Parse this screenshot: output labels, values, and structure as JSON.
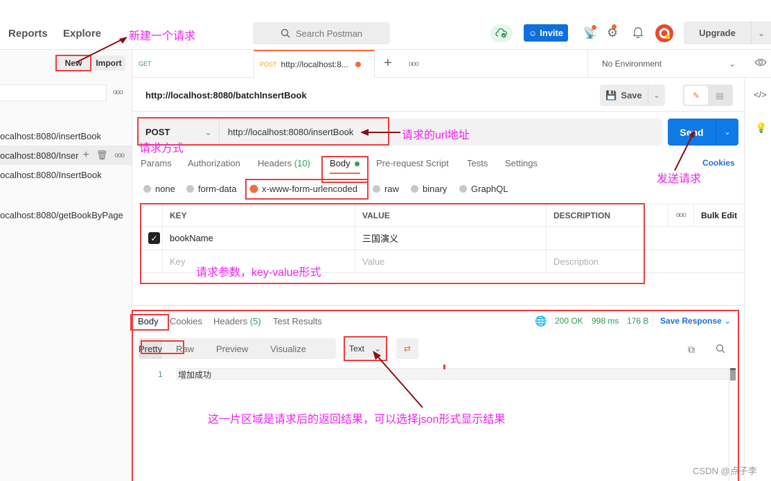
{
  "topbar": {
    "nav": [
      "Reports",
      "Explore"
    ],
    "search_placeholder": "Search Postman",
    "invite_label": "Invite",
    "upgrade_label": "Upgrade",
    "icons": [
      "cloud-sync-icon",
      "satellite-icon",
      "gear-icon",
      "bell-icon",
      "avatar"
    ]
  },
  "sidebar": {
    "new_label": "New",
    "import_label": "Import",
    "items": [
      {
        "label": "ocalhost:8080/insertBook"
      },
      {
        "label": "ocalhost:8080/Inser",
        "active": true
      },
      {
        "label": "ocalhost:8080/InsertBook"
      },
      {
        "label": "ocalhost:8080/getBookByPage"
      }
    ]
  },
  "tabs": [
    {
      "method": "GET",
      "label": ""
    },
    {
      "method": "POST",
      "label": "http://localhost:8...",
      "unsaved": true
    }
  ],
  "environment": {
    "selected": "No Environment"
  },
  "request": {
    "title": "http://localhost:8080/batchInsertBook",
    "save_label": "Save",
    "method": "POST",
    "url": "http://localhost:8080/insertBook",
    "send_label": "Send",
    "cookies_label": "Cookies",
    "tabs": [
      {
        "label": "Params"
      },
      {
        "label": "Authorization"
      },
      {
        "label": "Headers",
        "count": "(10)"
      },
      {
        "label": "Body",
        "active": true
      },
      {
        "label": "Pre-request Script"
      },
      {
        "label": "Tests"
      },
      {
        "label": "Settings"
      }
    ],
    "body_types": [
      "none",
      "form-data",
      "x-www-form-urlencoded",
      "raw",
      "binary",
      "GraphQL"
    ],
    "body_type_selected": "x-www-form-urlencoded",
    "params": {
      "headers": [
        "KEY",
        "VALUE",
        "DESCRIPTION"
      ],
      "bulk_edit": "Bulk Edit",
      "rows": [
        {
          "checked": true,
          "key": "bookName",
          "value": "三国演义",
          "description": ""
        }
      ],
      "placeholders": {
        "key": "Key",
        "value": "Value",
        "description": "Description"
      }
    }
  },
  "response": {
    "tabs": [
      {
        "label": "Body",
        "active": true
      },
      {
        "label": "Cookies"
      },
      {
        "label": "Headers",
        "count": "(5)"
      },
      {
        "label": "Test Results"
      }
    ],
    "status": "200 OK",
    "time": "998 ms",
    "size": "176 B",
    "save_response": "Save Response",
    "views": [
      "Pretty",
      "Raw",
      "Preview",
      "Visualize"
    ],
    "format": "Text",
    "lines": [
      {
        "no": "1",
        "text": "增加成功"
      }
    ]
  },
  "annotations": {
    "new_request": "新建一个请求",
    "url_address": "请求的url地址",
    "method": "请求方式",
    "send": "发送请求",
    "params": "请求参数，key-value形式",
    "result": "这一片区域是请求后的返回结果，可以选择json形式显示结果"
  },
  "colors": {
    "accent": "#f26b3a",
    "primary": "#0f7ae5",
    "success": "#2d9b5a",
    "annotation": "#f21ff2",
    "annotation_box": "#ef3b3b"
  },
  "watermark": "CSDN @点子李"
}
